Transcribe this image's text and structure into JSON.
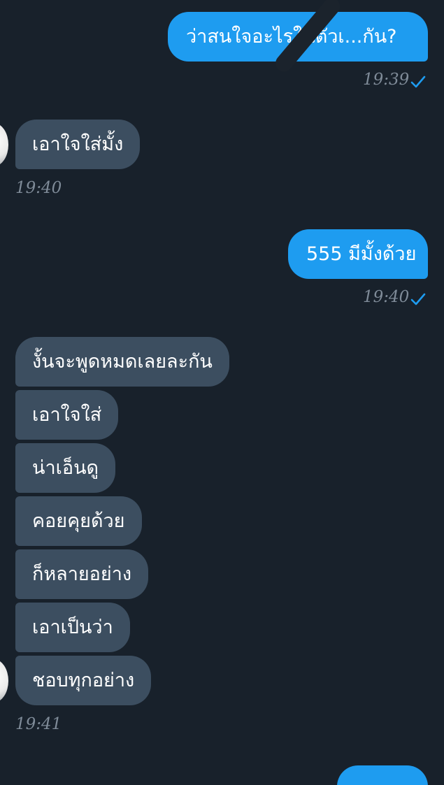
{
  "messages": [
    {
      "id": "m1",
      "direction": "outgoing",
      "text": "ว่าสนใจอะไรในตัวเ...กัน?",
      "time": "19:39",
      "status": "read"
    },
    {
      "id": "m2",
      "direction": "incoming",
      "text": "เอาใจใส่มั้ง",
      "time": "19:40"
    },
    {
      "id": "m3",
      "direction": "outgoing",
      "text": "555 มีมั้งด้วย",
      "time": "19:40",
      "status": "read"
    },
    {
      "id": "m4",
      "direction": "incoming",
      "text": "งั้นจะพูดหมดเลยละกัน"
    },
    {
      "id": "m5",
      "direction": "incoming",
      "text": "เอาใจใส่"
    },
    {
      "id": "m6",
      "direction": "incoming",
      "text": "น่าเอ็นดู"
    },
    {
      "id": "m7",
      "direction": "incoming",
      "text": "คอยคุยด้วย"
    },
    {
      "id": "m8",
      "direction": "incoming",
      "text": "ก็หลายอย่าง"
    },
    {
      "id": "m9",
      "direction": "incoming",
      "text": "เอาเป็นว่า"
    },
    {
      "id": "m10",
      "direction": "incoming",
      "text": "ชอบทุกอย่าง",
      "time": "19:41"
    }
  ],
  "icons": {
    "read_check": "check-icon",
    "avatar": "contact-avatar"
  },
  "colors": {
    "background": "#18212b",
    "outgoing_bubble": "#1e9cf0",
    "incoming_bubble": "#3c4e60",
    "timestamp": "#7f8b98",
    "check": "#1e9cf0"
  }
}
